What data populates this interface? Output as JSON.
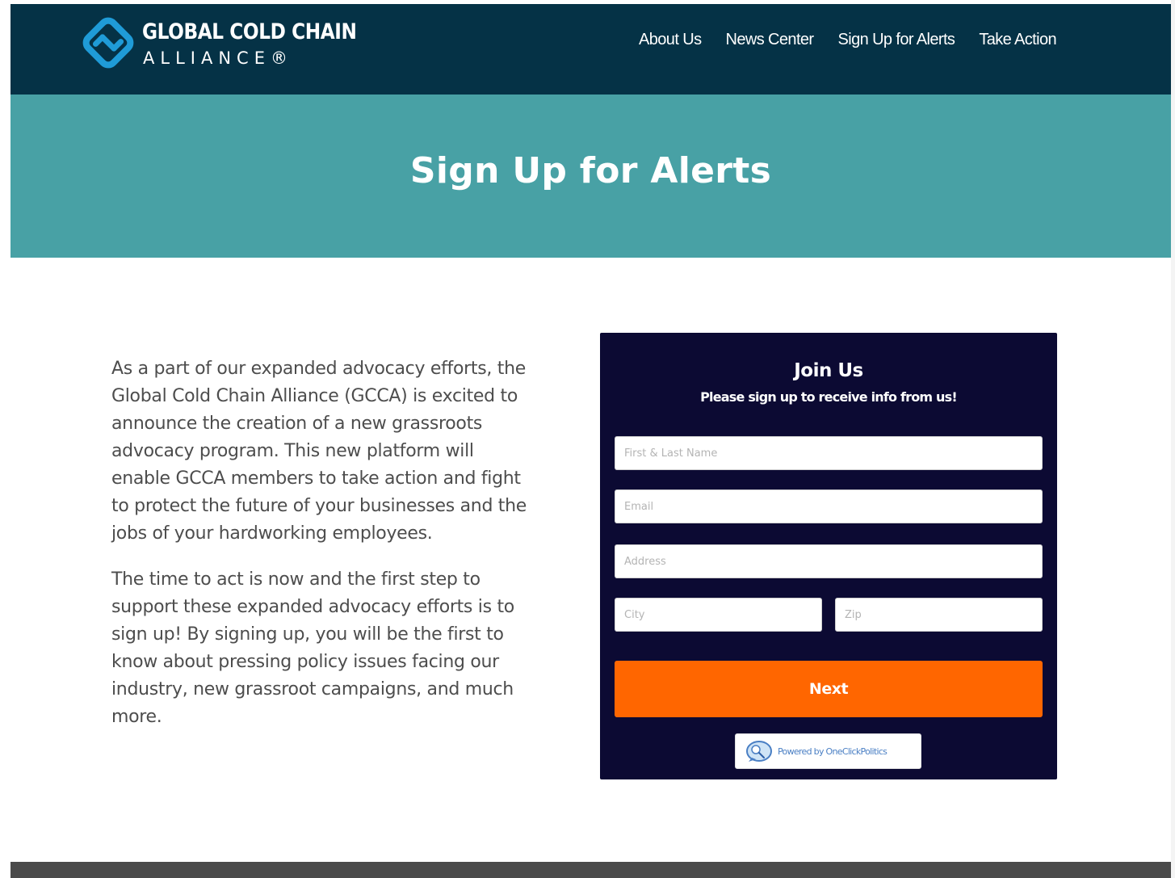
{
  "header": {
    "logo": {
      "line1": "GLOBAL COLD CHAIN",
      "line2": "ALLIANCE®",
      "icon": "gcca-logo-mark"
    },
    "nav": [
      {
        "label": "About Us"
      },
      {
        "label": "News Center"
      },
      {
        "label": "Sign Up for Alerts"
      },
      {
        "label": "Take Action"
      }
    ]
  },
  "hero": {
    "title": "Sign Up for Alerts"
  },
  "intro": {
    "paragraphs": [
      "As a part of our expanded advocacy efforts, the Global Cold Chain Alliance (GCCA) is excited to announce the creation of a new grassroots advocacy program. This new platform will enable GCCA members to take action and fight to protect the future of your businesses and the jobs of your hardworking employees.",
      "The time to act is now and the first step to support these expanded advocacy efforts is to sign up! By signing up, you will be the first to know about pressing policy issues facing our industry, new grassroot campaigns, and much more."
    ]
  },
  "form": {
    "title": "Join Us",
    "subtitle": "Please sign up to receive info from us!",
    "fields": {
      "name": {
        "placeholder": "First & Last Name",
        "value": ""
      },
      "email": {
        "placeholder": "Email",
        "value": ""
      },
      "address": {
        "placeholder": "Address",
        "value": ""
      },
      "city": {
        "placeholder": "City",
        "value": ""
      },
      "zip": {
        "placeholder": "Zip",
        "value": ""
      }
    },
    "submit_label": "Next",
    "powered_by": "Powered by OneClickPolitics",
    "powered_icon": "oneclickpolitics-logo-icon"
  },
  "colors": {
    "header_bg": "#053246",
    "hero_bg": "#48a1a5",
    "form_bg": "#0c0a33",
    "button_bg": "#ff6600",
    "logo_blue": "#1f9bd7"
  }
}
